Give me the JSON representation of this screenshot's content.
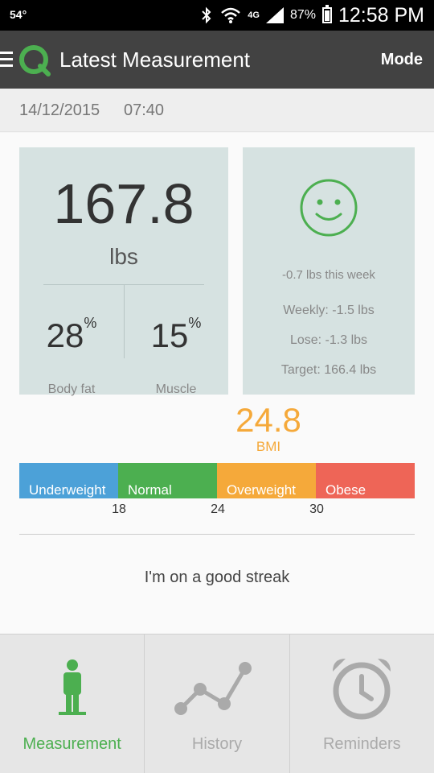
{
  "status_bar": {
    "temperature": "54°",
    "network": "4G",
    "battery_percent": "87%",
    "time": "12:58 PM"
  },
  "app_bar": {
    "title": "Latest Measurement",
    "mode_label": "Mode"
  },
  "date_bar": {
    "date": "14/12/2015",
    "time": "07:40"
  },
  "weight_card": {
    "value": "167.8",
    "unit": "lbs",
    "body_fat_value": "28",
    "body_fat_unit": "%",
    "body_fat_label": "Body fat",
    "muscle_value": "15",
    "muscle_unit": "%",
    "muscle_label": "Muscle"
  },
  "trend_card": {
    "mood_icon": "smiley-icon",
    "week_change": "-0.7 lbs this week",
    "weekly": "Weekly: -1.5 lbs",
    "lose": "Lose: -1.3 lbs",
    "target": "Target: 166.4 lbs"
  },
  "bmi": {
    "value": "24.8",
    "label": "BMI",
    "segments": [
      {
        "label": "Underweight",
        "color": "#4ca1d8"
      },
      {
        "label": "Normal",
        "color": "#4caf50"
      },
      {
        "label": "Overweight",
        "color": "#f5a93a"
      },
      {
        "label": "Obese",
        "color": "#ee6557"
      }
    ],
    "ticks": [
      "18",
      "24",
      "30"
    ]
  },
  "streak_message": "I'm on a good streak",
  "bottom_nav": {
    "items": [
      {
        "label": "Measurement",
        "icon": "person-icon",
        "active": true
      },
      {
        "label": "History",
        "icon": "line-chart-icon",
        "active": false
      },
      {
        "label": "Reminders",
        "icon": "alarm-clock-icon",
        "active": false
      }
    ]
  },
  "colors": {
    "accent": "#4caf50",
    "bmi_value": "#f5a93a",
    "card_bg": "#d6e2e1",
    "app_bar": "#424242"
  }
}
